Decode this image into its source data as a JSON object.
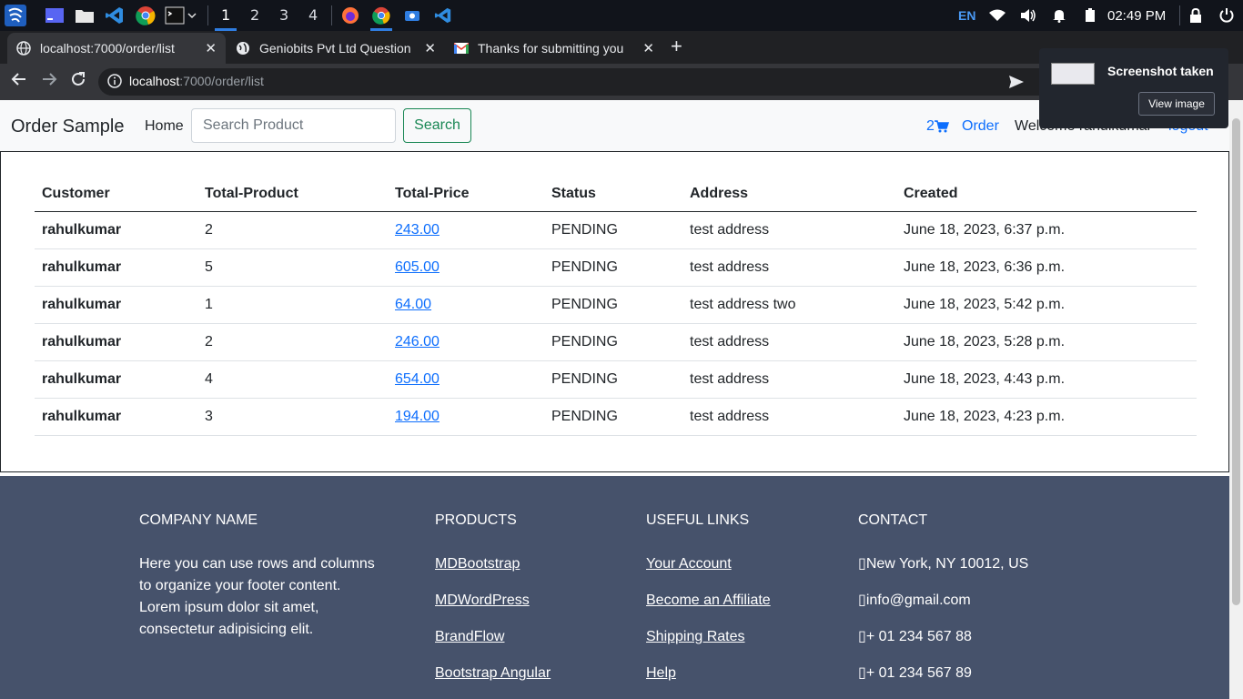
{
  "taskbar": {
    "workspaces": [
      "1",
      "2",
      "3",
      "4"
    ],
    "language": "EN",
    "clock": "02:49 PM"
  },
  "browser": {
    "tabs": [
      {
        "title": "localhost:7000/order/list"
      },
      {
        "title": "Geniobits Pvt Ltd Question"
      },
      {
        "title": "Thanks for submitting you"
      }
    ],
    "url_host": "localhost",
    "url_path": ":7000/order/list"
  },
  "navbar": {
    "brand": "Order Sample",
    "home": "Home",
    "search_placeholder": "Search Product",
    "search_button": "Search",
    "cart_count": "2",
    "order": "Order",
    "welcome": "Welcome rahulkumar",
    "logout": "logout"
  },
  "orders": {
    "headers": [
      "Customer",
      "Total-Product",
      "Total-Price",
      "Status",
      "Address",
      "Created"
    ],
    "rows": [
      {
        "customer": "rahulkumar",
        "total_product": "2",
        "total_price": "243.00",
        "status": "PENDING",
        "address": "test address",
        "created": "June 18, 2023, 6:37 p.m."
      },
      {
        "customer": "rahulkumar",
        "total_product": "5",
        "total_price": "605.00",
        "status": "PENDING",
        "address": "test address",
        "created": "June 18, 2023, 6:36 p.m."
      },
      {
        "customer": "rahulkumar",
        "total_product": "1",
        "total_price": "64.00",
        "status": "PENDING",
        "address": "test address two",
        "created": "June 18, 2023, 5:42 p.m."
      },
      {
        "customer": "rahulkumar",
        "total_product": "2",
        "total_price": "246.00",
        "status": "PENDING",
        "address": "test address",
        "created": "June 18, 2023, 5:28 p.m."
      },
      {
        "customer": "rahulkumar",
        "total_product": "4",
        "total_price": "654.00",
        "status": "PENDING",
        "address": "test address",
        "created": "June 18, 2023, 4:43 p.m."
      },
      {
        "customer": "rahulkumar",
        "total_product": "3",
        "total_price": "194.00",
        "status": "PENDING",
        "address": "test address",
        "created": "June 18, 2023, 4:23 p.m."
      }
    ]
  },
  "footer": {
    "company": {
      "heading": "COMPANY NAME",
      "text": "Here you can use rows and columns to organize your footer content. Lorem ipsum dolor sit amet, consectetur adipisicing elit."
    },
    "products": {
      "heading": "PRODUCTS",
      "links": [
        "MDBootstrap",
        "MDWordPress",
        "BrandFlow",
        "Bootstrap Angular"
      ]
    },
    "useful_links": {
      "heading": "USEFUL LINKS",
      "links": [
        "Your Account",
        "Become an Affiliate",
        "Shipping Rates",
        "Help"
      ]
    },
    "contact": {
      "heading": "CONTACT",
      "items": [
        "New York, NY 10012, US",
        "info@gmail.com",
        "+ 01 234 567 88",
        "+ 01 234 567 89"
      ]
    }
  },
  "notification": {
    "title": "Screenshot taken",
    "button": "View image"
  },
  "colors": {
    "link": "#0d6efd",
    "success": "#198754",
    "footer_bg": "#46526b",
    "navbar_bg": "#f8f9fa"
  }
}
